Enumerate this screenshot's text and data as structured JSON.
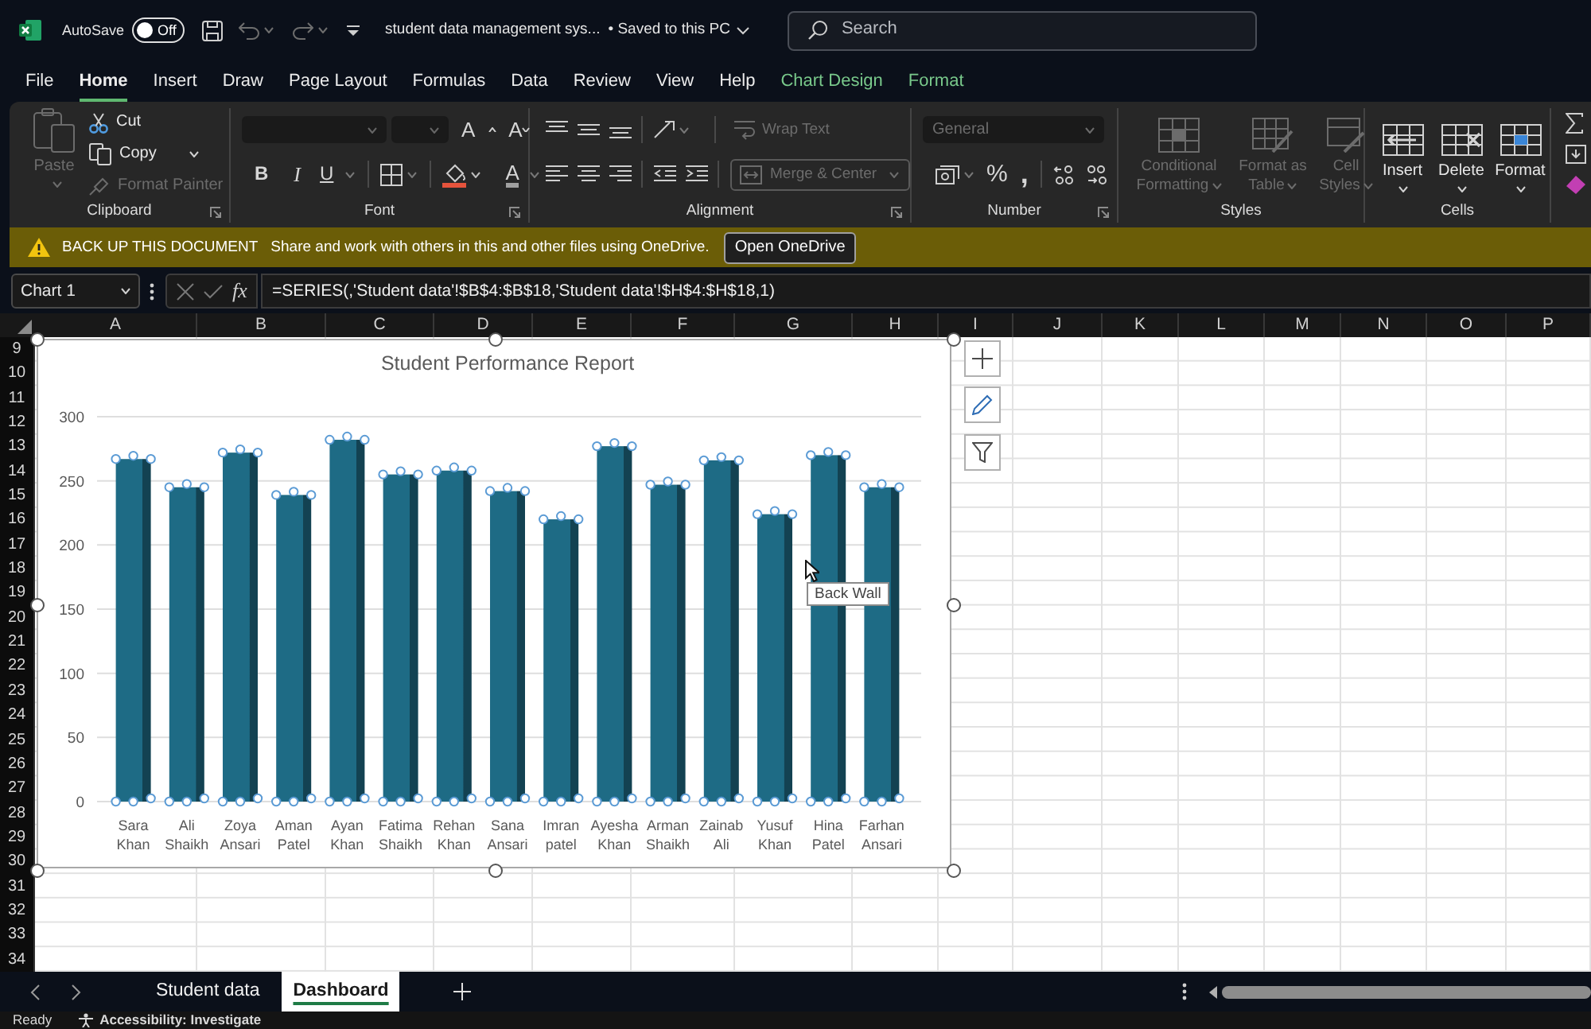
{
  "title_bar": {
    "autosave": {
      "label": "AutoSave",
      "on": false,
      "state_text": "Off"
    },
    "file_name": "student data management sys...",
    "save_status": "• Saved to this PC",
    "search": {
      "placeholder": "Search"
    }
  },
  "menu_tabs": [
    {
      "label": "File",
      "selected": false,
      "kind": "standard"
    },
    {
      "label": "Home",
      "selected": true,
      "kind": "standard"
    },
    {
      "label": "Insert",
      "selected": false,
      "kind": "standard"
    },
    {
      "label": "Draw",
      "selected": false,
      "kind": "standard"
    },
    {
      "label": "Page Layout",
      "selected": false,
      "kind": "standard"
    },
    {
      "label": "Formulas",
      "selected": false,
      "kind": "standard"
    },
    {
      "label": "Data",
      "selected": false,
      "kind": "standard"
    },
    {
      "label": "Review",
      "selected": false,
      "kind": "standard"
    },
    {
      "label": "View",
      "selected": false,
      "kind": "standard"
    },
    {
      "label": "Help",
      "selected": false,
      "kind": "standard"
    },
    {
      "label": "Chart Design",
      "selected": false,
      "kind": "contextual"
    },
    {
      "label": "Format",
      "selected": false,
      "kind": "contextual"
    }
  ],
  "ribbon": {
    "clipboard": {
      "label": "Clipboard",
      "paste": {
        "label": "Paste",
        "disabled": true
      },
      "cut": {
        "label": "Cut",
        "disabled": false
      },
      "copy": {
        "label": "Copy",
        "disabled": false
      },
      "format_painter": {
        "label": "Format Painter",
        "disabled": true
      }
    },
    "font": {
      "label": "Font",
      "grow_font": "A",
      "shrink_font": "A",
      "bold": "B",
      "italic": "I",
      "underline": "U",
      "font_color": "A"
    },
    "alignment": {
      "label": "Alignment",
      "wrap_text": {
        "label": "Wrap Text",
        "disabled": true
      },
      "merge_center": {
        "label": "Merge & Center",
        "disabled": true
      }
    },
    "number": {
      "label": "Number",
      "format": {
        "value": "General",
        "disabled": true
      },
      "percent": "%",
      "comma": ","
    },
    "styles": {
      "label": "Styles",
      "buttons": [
        {
          "label": "Conditional Formatting",
          "disabled": true
        },
        {
          "label": "Format as Table",
          "disabled": true
        },
        {
          "label": "Cell Styles",
          "disabled": true
        }
      ]
    },
    "cells": {
      "label": "Cells",
      "buttons": [
        {
          "label": "Insert",
          "disabled": false
        },
        {
          "label": "Delete",
          "disabled": false
        },
        {
          "label": "Format",
          "disabled": false
        }
      ]
    }
  },
  "message_bar": {
    "title": "BACK UP THIS DOCUMENT",
    "message": "Share and work with others in this and other files using OneDrive.",
    "button": "Open OneDrive"
  },
  "formula_bar": {
    "name_box": "Chart 1",
    "function_label": "fx",
    "formula": "=SERIES(,'Student data'!$B$4:$B$18,'Student data'!$H$4:$H$18,1)"
  },
  "sheet": {
    "columns": [
      "A",
      "B",
      "C",
      "D",
      "E",
      "F",
      "G",
      "H",
      "I",
      "J",
      "K",
      "L",
      "M",
      "N",
      "O",
      "P"
    ],
    "rows": [
      "9",
      "10",
      "11",
      "12",
      "13",
      "14",
      "15",
      "16",
      "17",
      "18",
      "19",
      "20",
      "21",
      "22",
      "23",
      "24",
      "25",
      "26",
      "27",
      "28",
      "29",
      "30",
      "31",
      "32",
      "33",
      "34"
    ]
  },
  "chart": {
    "selected": true,
    "series_selected": true,
    "tooltip": "Back Wall",
    "chart_data": {
      "type": "bar",
      "title": "Student Performance Report",
      "categories": [
        "Sara Khan",
        "Ali Shaikh",
        "Zoya Ansari",
        "Aman Patel",
        "Ayan Khan",
        "Fatima Shaikh",
        "Rehan Khan",
        "Sana Ansari",
        "Imran patel",
        "Ayesha Khan",
        "Arman Shaikh",
        "Zainab Ali",
        "Yusuf Khan",
        "Hina Patel",
        "Farhan Ansari"
      ],
      "values": [
        267,
        245,
        272,
        239,
        282,
        255,
        258,
        242,
        220,
        277,
        247,
        266,
        224,
        270,
        245
      ],
      "color": "#1e6b85",
      "ylim": [
        0,
        300
      ],
      "yticks": [
        0,
        50,
        100,
        150,
        200,
        250,
        300
      ],
      "grid": true
    }
  },
  "sheet_tabs": [
    {
      "label": "Student data",
      "selected": false
    },
    {
      "label": "Dashboard",
      "selected": true
    }
  ],
  "status_bar": {
    "ready": "Ready",
    "accessibility": "Accessibility: Investigate"
  }
}
